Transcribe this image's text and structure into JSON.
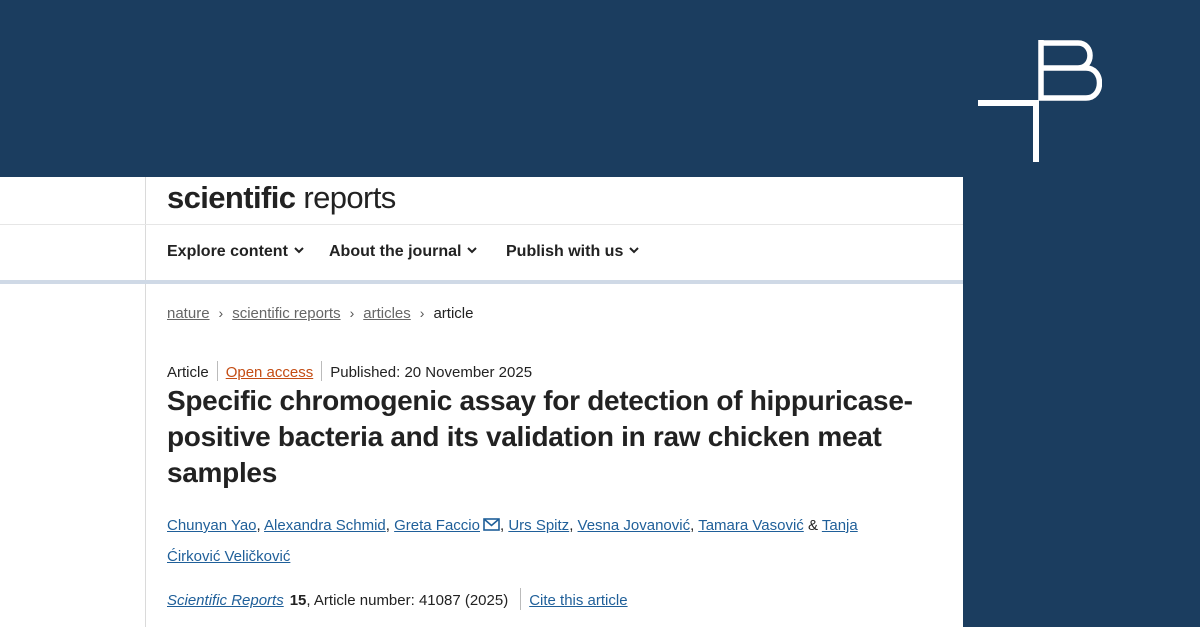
{
  "brand": {
    "bold": "scientific",
    "light": " reports"
  },
  "nav": [
    {
      "label": "Explore content"
    },
    {
      "label": "About the journal"
    },
    {
      "label": "Publish with us"
    }
  ],
  "breadcrumb": {
    "items": [
      "nature",
      "scientific reports",
      "articles"
    ],
    "current": "article"
  },
  "article": {
    "type": "Article",
    "access": "Open access",
    "published": "Published: 20 November 2025",
    "title": "Specific chromogenic assay for detection of hippuricase-positive bacteria and its validation in raw chicken meat samples",
    "authors": [
      "Chunyan Yao",
      "Alexandra Schmid",
      "Greta Faccio",
      "Urs Spitz",
      "Vesna Jovanović",
      "Tamara Vasović",
      "Tanja Ćirković Veličković"
    ],
    "author_separator": ", ",
    "author_last_separator": " & ",
    "journal": "Scientific Reports",
    "volume": "15",
    "article_number": ", Article number: 41087 (2025)",
    "cite_label": "Cite this article"
  },
  "icons": {
    "nav_chevron": "chevron-down-icon",
    "breadcrumb_sep": "chevron-right-icon",
    "email": "email-icon",
    "logo": "b-monogram-logo"
  },
  "colors": {
    "background": "#1b3d5f",
    "link": "#1f5f99",
    "open_access": "#c44d14",
    "nav_bar": "#cfd9e6"
  }
}
